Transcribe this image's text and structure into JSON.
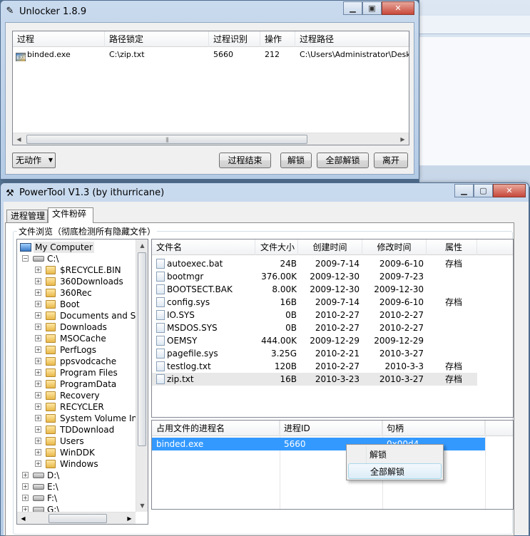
{
  "desktop": {
    "bg": "#5b7da0"
  },
  "unlocker": {
    "title": "Unlocker 1.8.9",
    "columns": [
      "过程",
      "路径锁定",
      "过程识别",
      "操作",
      "过程路径"
    ],
    "rows": [
      {
        "process": "binded.exe",
        "locked_path": "C:\\zip.txt",
        "pid": "5660",
        "handle": "212",
        "process_path": "C:\\Users\\Administrator\\Desktop"
      }
    ],
    "action_select": "无动作",
    "buttons": {
      "kill": "过程结束",
      "unlock": "解锁",
      "unlock_all": "全部解锁",
      "quit": "离开"
    }
  },
  "powertool": {
    "title": "PowerTool V1.3 (by ithurricane)",
    "tabs": [
      "进程管理",
      "文件粉碎"
    ],
    "group_caption": "文件浏览（彻底检测所有隐藏文件）",
    "tree": {
      "root": "My Computer",
      "drive_c": "C:\\",
      "folders": [
        "$RECYCLE.BIN",
        "360Downloads",
        "360Rec",
        "Boot",
        "Documents and Se",
        "Downloads",
        "MSOCache",
        "PerfLogs",
        "ppsvodcache",
        "Program Files",
        "ProgramData",
        "Recovery",
        "RECYCLER",
        "System Volume Inf",
        "TDDownload",
        "Users",
        "WinDDK",
        "Windows"
      ],
      "drives": [
        "D:\\",
        "E:\\",
        "F:\\",
        "G:\\"
      ]
    },
    "file_columns": [
      "文件名",
      "文件大小",
      "创建时间",
      "修改时间",
      "属性"
    ],
    "files": [
      {
        "name": "autoexec.bat",
        "size": "24B",
        "created": "2009-7-14",
        "modified": "2009-6-10",
        "attr": "存档"
      },
      {
        "name": "bootmgr",
        "size": "376.00K",
        "created": "2009-12-30",
        "modified": "2009-7-23",
        "attr": ""
      },
      {
        "name": "BOOTSECT.BAK",
        "size": "8.00K",
        "created": "2009-12-30",
        "modified": "2009-12-30",
        "attr": ""
      },
      {
        "name": "config.sys",
        "size": "16B",
        "created": "2009-7-14",
        "modified": "2009-6-10",
        "attr": "存档"
      },
      {
        "name": "IO.SYS",
        "size": "0B",
        "created": "2010-2-27",
        "modified": "2010-2-27",
        "attr": ""
      },
      {
        "name": "MSDOS.SYS",
        "size": "0B",
        "created": "2010-2-27",
        "modified": "2010-2-27",
        "attr": ""
      },
      {
        "name": "OEMSY",
        "size": "444.00K",
        "created": "2009-12-29",
        "modified": "2009-12-29",
        "attr": ""
      },
      {
        "name": "pagefile.sys",
        "size": "3.25G",
        "created": "2010-2-21",
        "modified": "2010-3-27",
        "attr": ""
      },
      {
        "name": "testlog.txt",
        "size": "120B",
        "created": "2010-2-27",
        "modified": "2010-3-3",
        "attr": "存档"
      },
      {
        "name": "zip.txt",
        "size": "16B",
        "created": "2010-3-23",
        "modified": "2010-3-27",
        "attr": "存档"
      }
    ],
    "proc_columns": [
      "占用文件的进程名",
      "进程ID",
      "句柄"
    ],
    "proc_rows": [
      {
        "name": "binded.exe",
        "pid": "5660",
        "handle": "0x00d4"
      }
    ],
    "context_menu": [
      "解锁",
      "全部解锁"
    ]
  },
  "icons": {
    "unlocker_title": "wand-icon",
    "powertool_title": "tools-icon",
    "minimize": "minimize-icon",
    "maximize": "maximize-icon",
    "close": "close-icon"
  }
}
